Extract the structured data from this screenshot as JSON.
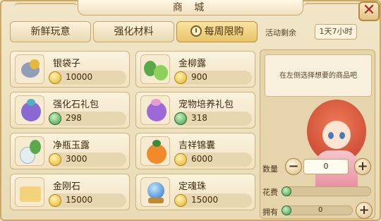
{
  "title": "商  城",
  "close_label": "✕",
  "tabs": [
    {
      "label": "新鲜玩意"
    },
    {
      "label": "强化材料"
    },
    {
      "label": "每周限购"
    }
  ],
  "activity": {
    "label": "活动剩余",
    "value": "1天7小时"
  },
  "items": [
    {
      "name": "银袋子",
      "price": "10000",
      "currency": "gold"
    },
    {
      "name": "金柳露",
      "price": "900",
      "currency": "gold"
    },
    {
      "name": "强化石礼包",
      "price": "298",
      "currency": "jade"
    },
    {
      "name": "宠物培养礼包",
      "price": "318",
      "currency": "jade"
    },
    {
      "name": "净瓶玉露",
      "price": "3000",
      "currency": "gold"
    },
    {
      "name": "吉祥锦囊",
      "price": "6000",
      "currency": "gold"
    },
    {
      "name": "金刚石",
      "price": "15000",
      "currency": "gold"
    },
    {
      "name": "定魂珠",
      "price": "15000",
      "currency": "gold"
    }
  ],
  "panel": {
    "hint": "在左侧选择想要的商品吧",
    "qty_label": "数量",
    "qty_value": "0",
    "cost_label": "花费",
    "own_label": "拥有",
    "own_value": "0",
    "minus": "−",
    "plus": "+"
  },
  "colors": {
    "accent": "#e7c46a",
    "close": "#b4231c",
    "frame": "#c9a86a"
  }
}
